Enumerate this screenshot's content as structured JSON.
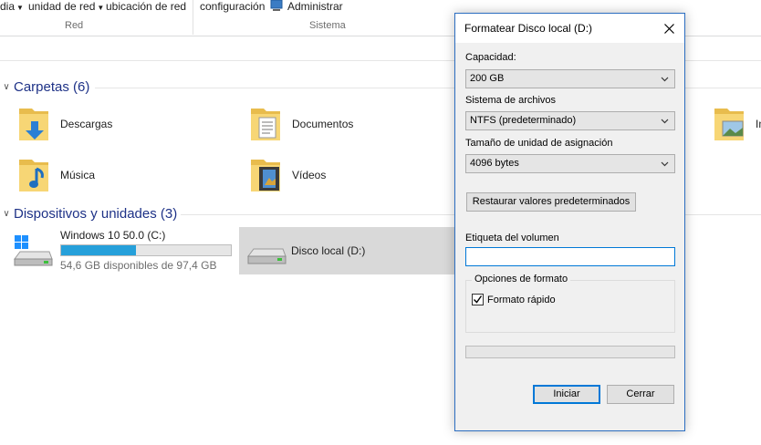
{
  "ribbon": {
    "item1": "dia",
    "item2": "unidad de red",
    "item3": "ubicación de red",
    "item4": "configuración",
    "item5": "Administrar",
    "group_red": "Red",
    "group_sistema": "Sistema"
  },
  "folders": {
    "header": "Carpetas (6)",
    "items": [
      {
        "label": "Descargas",
        "icon": "folder-downloads-icon"
      },
      {
        "label": "Documentos",
        "icon": "folder-documents-icon"
      },
      {
        "label": "Música",
        "icon": "folder-music-icon"
      },
      {
        "label": "Vídeos",
        "icon": "folder-videos-icon"
      },
      {
        "label": "Im",
        "icon": "folder-pictures-icon"
      }
    ]
  },
  "devices": {
    "header": "Dispositivos y unidades (3)",
    "drives": [
      {
        "name": "Windows 10 50.0 (C:)",
        "free": "54,6 GB disponibles de 97,4 GB",
        "used_fraction": 0.44
      },
      {
        "name": "Disco local (D:)"
      }
    ]
  },
  "dialog": {
    "title": "Formatear Disco local (D:)",
    "capacity_label": "Capacidad:",
    "capacity_value": "200 GB",
    "fs_label": "Sistema de archivos",
    "fs_value": "NTFS (predeterminado)",
    "alloc_label": "Tamaño de unidad de asignación",
    "alloc_value": "4096 bytes",
    "restore_button": "Restaurar valores predeterminados",
    "volume_label": "Etiqueta del volumen",
    "volume_value": "",
    "format_options_label": "Opciones de formato",
    "quick_format_label": "Formato rápido",
    "quick_format_checked": true,
    "progress": 0,
    "start_button": "Iniciar",
    "cancel_button": "Cerrar"
  },
  "colors": {
    "accent": "#0078d7",
    "section_title": "#1e3287",
    "drive_bar": "#26a0da",
    "selection": "#d9d9d9"
  }
}
